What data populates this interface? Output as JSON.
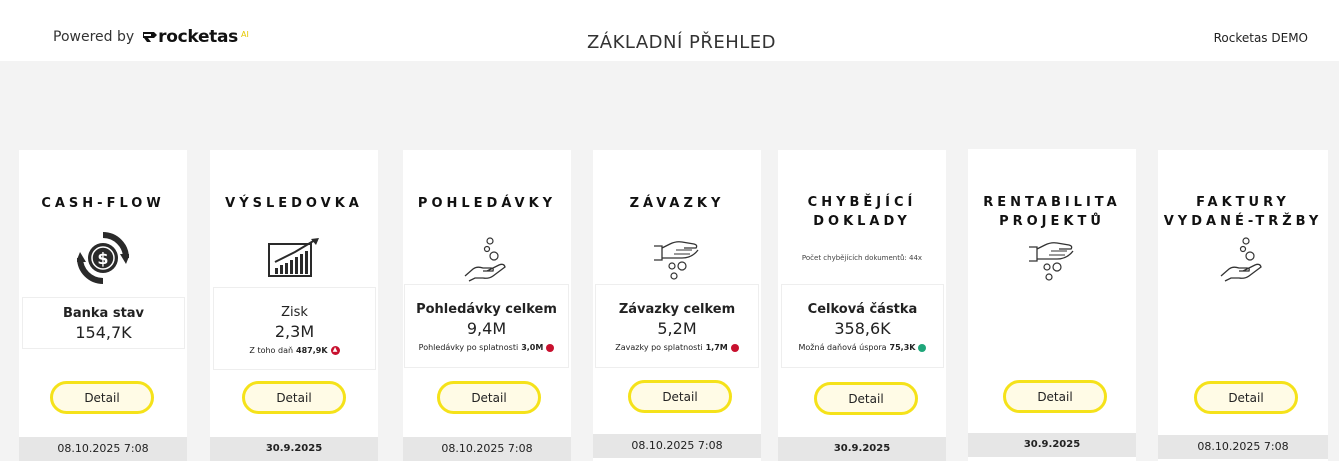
{
  "header": {
    "powered_by": "Powered by",
    "logo_text": "rocketas",
    "logo_suffix": "AI",
    "page_title": "ZÁKLADNÍ PŘEHLED",
    "company": "Rocketas DEMO"
  },
  "accent_color": "#f5e21a",
  "cards": [
    {
      "title_line1": "CASH-FLOW",
      "title_line2": "",
      "icon": "dollar-cycle-icon",
      "kpi_label": "Banka stav",
      "kpi_value": "154,7K",
      "detail_label": "Detail",
      "date": "08.10.2025 7:08"
    },
    {
      "title_line1": "VÝSLEDOVKA",
      "title_line2": "",
      "icon": "growth-chart-icon",
      "kpi_label": "Zisk",
      "kpi_value": "2,3M",
      "sub_label": "Z toho daň",
      "sub_value": "487,9K",
      "sub_status": "up-red",
      "detail_label": "Detail",
      "date": "30.9.2025"
    },
    {
      "title_line1": "POHLEDÁVKY",
      "title_line2": "",
      "icon": "receiving-coins-icon",
      "kpi_label": "Pohledávky celkem",
      "kpi_value": "9,4M",
      "sub_label": "Pohledávky po splatnosti",
      "sub_value": "3,0M",
      "sub_status": "red",
      "detail_label": "Detail",
      "date": "08.10.2025 7:08"
    },
    {
      "title_line1": "ZÁVAZKY",
      "title_line2": "",
      "icon": "giving-coins-icon",
      "kpi_label": "Závazky celkem",
      "kpi_value": "5,2M",
      "sub_label": "Zavazky po splatnosti",
      "sub_value": "1,7M",
      "sub_status": "red",
      "detail_label": "Detail",
      "date": "08.10.2025 7:08"
    },
    {
      "title_line1": "CHYBĚJÍCÍ",
      "title_line2": "DOKLADY",
      "missing_count": "Počet chybějících dokumentů: 44x",
      "kpi_label": "Celková částka",
      "kpi_value": "358,6K",
      "sub_label": "Možná daňová úspora",
      "sub_value": "75,3K",
      "sub_status": "green",
      "detail_label": "Detail",
      "date": "30.9.2025"
    },
    {
      "title_line1": "RENTABILITA",
      "title_line2": "PROJEKTŮ",
      "icon": "giving-coins-icon",
      "detail_label": "Detail",
      "date": "30.9.2025"
    },
    {
      "title_line1": "FAKTURY",
      "title_line2": "VYDANÉ-TRŽBY",
      "icon": "receiving-coins-icon",
      "detail_label": "Detail",
      "date": "08.10.2025 7:08"
    }
  ]
}
